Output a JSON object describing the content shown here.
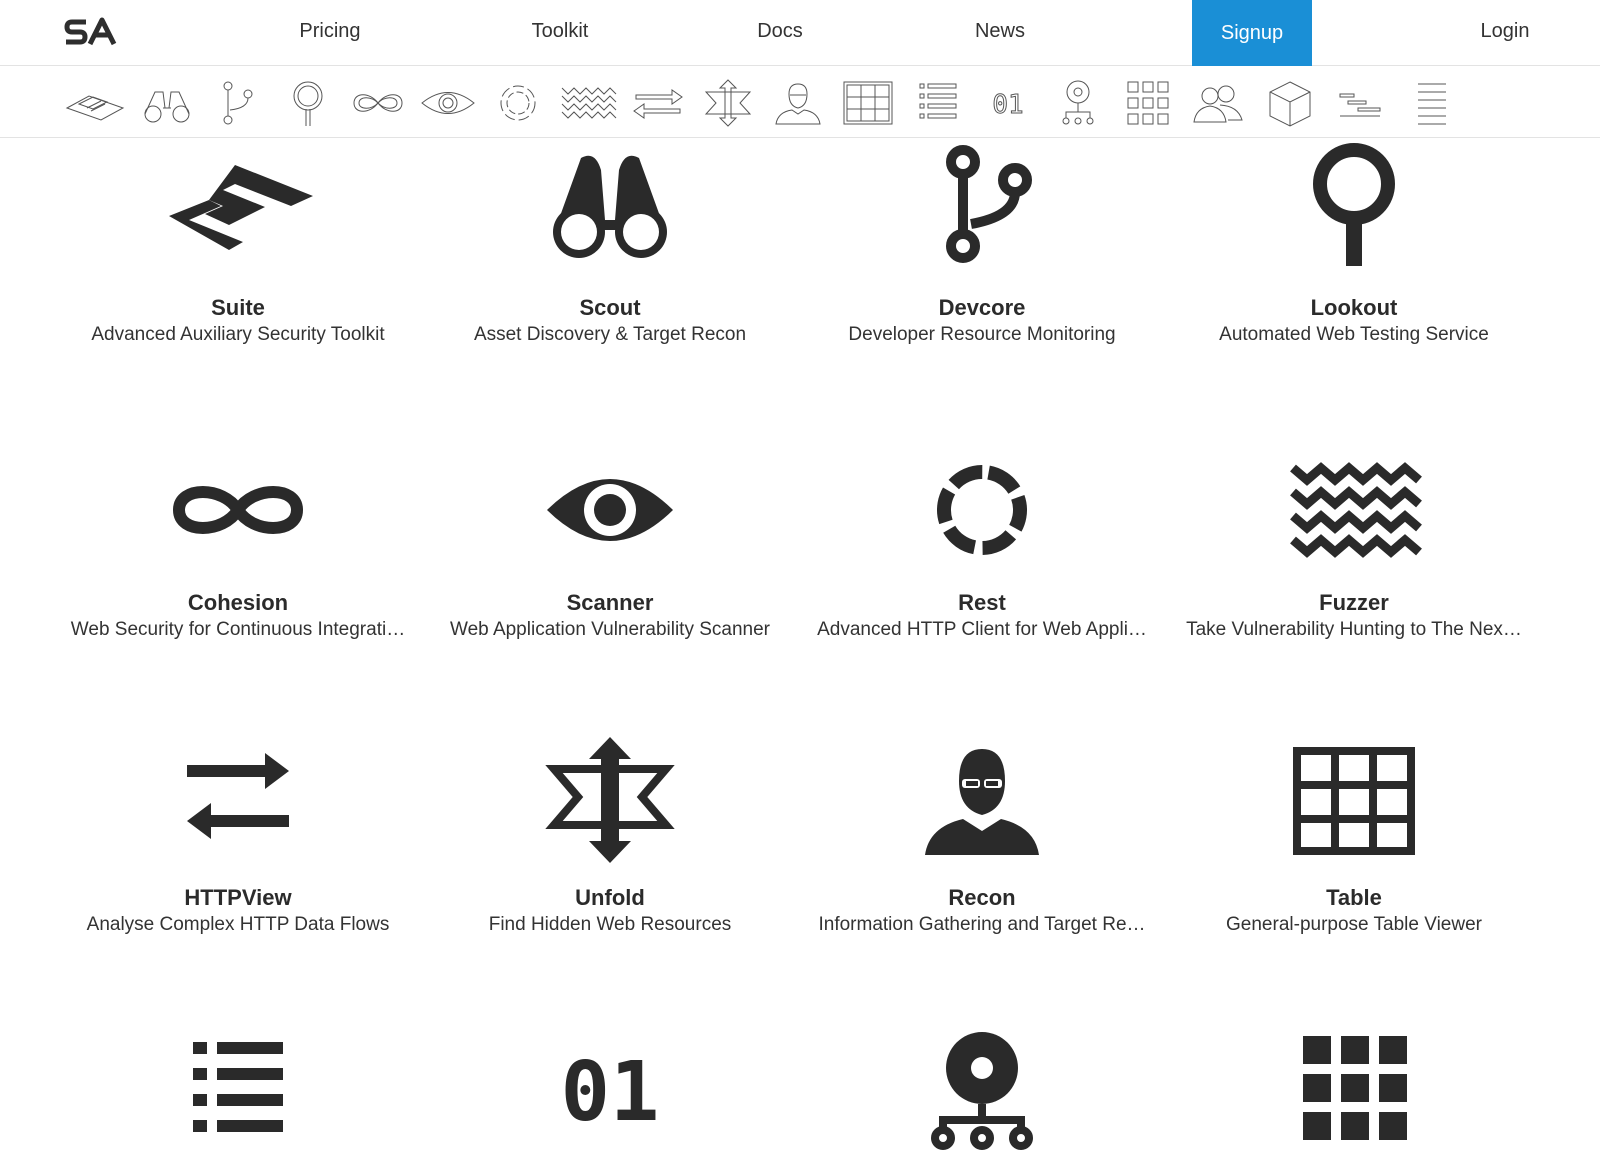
{
  "nav": {
    "logo_text": "SA",
    "pricing": "Pricing",
    "toolkit": "Toolkit",
    "docs": "Docs",
    "news": "News",
    "signup": "Signup",
    "login": "Login",
    "accent": "#1a8fd6"
  },
  "icon_strip": [
    "suite-icon",
    "binoculars-icon",
    "branch-icon",
    "lookout-pin-icon",
    "infinity-icon",
    "eye-icon",
    "ring-icon",
    "zigzag-icon",
    "arrows-exchange-icon",
    "unfold-arrows-icon",
    "person-sunglasses-icon",
    "table-icon",
    "list-icon",
    "binary-01-icon",
    "network-node-icon",
    "grid-icon",
    "users-icon",
    "cube-icon",
    "gantt-icon",
    "lines-icon"
  ],
  "tools": [
    {
      "name": "Suite",
      "desc": "Advanced Auxiliary Security Toolkit",
      "icon": "suite-icon"
    },
    {
      "name": "Scout",
      "desc": "Asset Discovery & Target Recon",
      "icon": "binoculars-icon"
    },
    {
      "name": "Devcore",
      "desc": "Developer Resource Monitoring",
      "icon": "branch-icon"
    },
    {
      "name": "Lookout",
      "desc": "Automated Web Testing Service",
      "icon": "lookout-pin-icon"
    },
    {
      "name": "Cohesion",
      "desc": "Web Security for Continuous Integrati…",
      "icon": "infinity-icon"
    },
    {
      "name": "Scanner",
      "desc": "Web Application Vulnerability Scanner",
      "icon": "eye-icon"
    },
    {
      "name": "Rest",
      "desc": "Advanced HTTP Client for Web Appli…",
      "icon": "ring-icon"
    },
    {
      "name": "Fuzzer",
      "desc": "Take Vulnerability Hunting to The Nex…",
      "icon": "zigzag-icon"
    },
    {
      "name": "HTTPView",
      "desc": "Analyse Complex HTTP Data Flows",
      "icon": "arrows-exchange-icon"
    },
    {
      "name": "Unfold",
      "desc": "Find Hidden Web Resources",
      "icon": "unfold-arrows-icon"
    },
    {
      "name": "Recon",
      "desc": "Information Gathering and Target Re…",
      "icon": "person-sunglasses-icon"
    },
    {
      "name": "Table",
      "desc": "General-purpose Table Viewer",
      "icon": "table-icon"
    }
  ],
  "partial_row_icons": [
    "list-icon",
    "binary-01-icon",
    "network-node-icon",
    "grid-icon"
  ],
  "binary_text": "01"
}
